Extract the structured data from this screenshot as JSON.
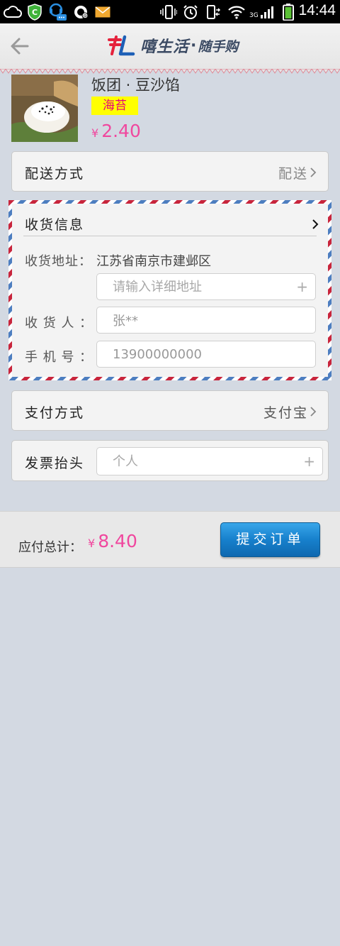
{
  "status_bar": {
    "time": "14:44",
    "network": "3G"
  },
  "header": {
    "logo_text": "嘻生活",
    "logo_separator": "·",
    "logo_sub": "随手购"
  },
  "product": {
    "name": "饭团 · 豆沙馅",
    "tag": "海苔",
    "currency": "¥",
    "price": "2.40"
  },
  "delivery": {
    "label": "配送方式",
    "value": "配送"
  },
  "shipping": {
    "title": "收货信息",
    "address_label": "收货地址：",
    "address_value": "江苏省南京市建邺区",
    "detail_placeholder": "请输入详细地址",
    "receiver_label": "收 货 人 ：",
    "receiver_value": "张**",
    "phone_label": "手 机 号 ：",
    "phone_value": "13900000000"
  },
  "payment": {
    "label": "支付方式",
    "value": "支付宝"
  },
  "invoice": {
    "label": "发票抬头",
    "placeholder": "个人"
  },
  "total": {
    "label": "应付总计：",
    "currency": "¥",
    "amount": "8.40"
  },
  "submit": {
    "label": "提交订单"
  },
  "colors": {
    "price_pink": "#f0479e",
    "tag_yellow": "#ffff00",
    "airmail_red": "#c8253c",
    "airmail_blue": "#4d7ec0",
    "button_blue": "#1780cc"
  }
}
